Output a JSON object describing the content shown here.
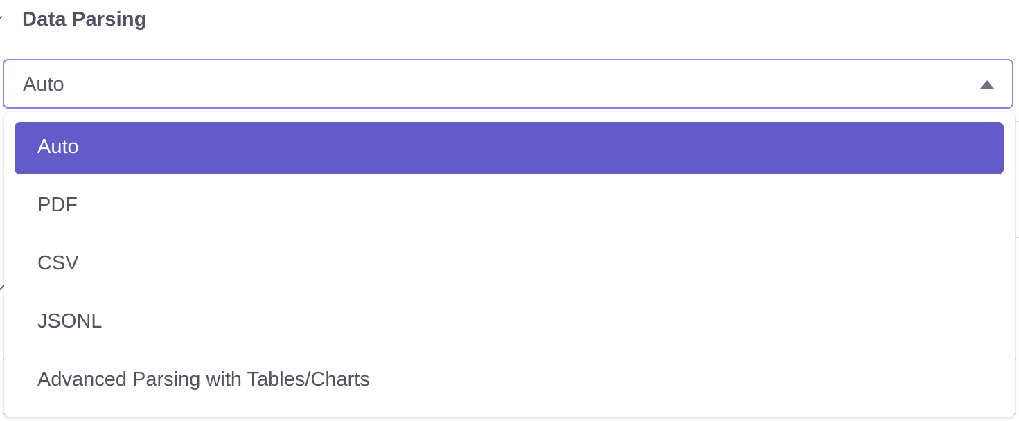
{
  "section": {
    "title": "Data Parsing"
  },
  "select": {
    "value": "Auto"
  },
  "menu": {
    "options": [
      {
        "label": "Auto"
      },
      {
        "label": "PDF"
      },
      {
        "label": "CSV"
      },
      {
        "label": "JSONL"
      },
      {
        "label": "Advanced Parsing with Tables/Charts"
      }
    ],
    "selected_label": "Auto"
  },
  "colors": {
    "accent": "#645bca",
    "focus_border": "#8b80e6",
    "text": "#4f5260"
  },
  "icons": {
    "collapse": "chevron-down-icon",
    "caret": "caret-up-icon"
  }
}
